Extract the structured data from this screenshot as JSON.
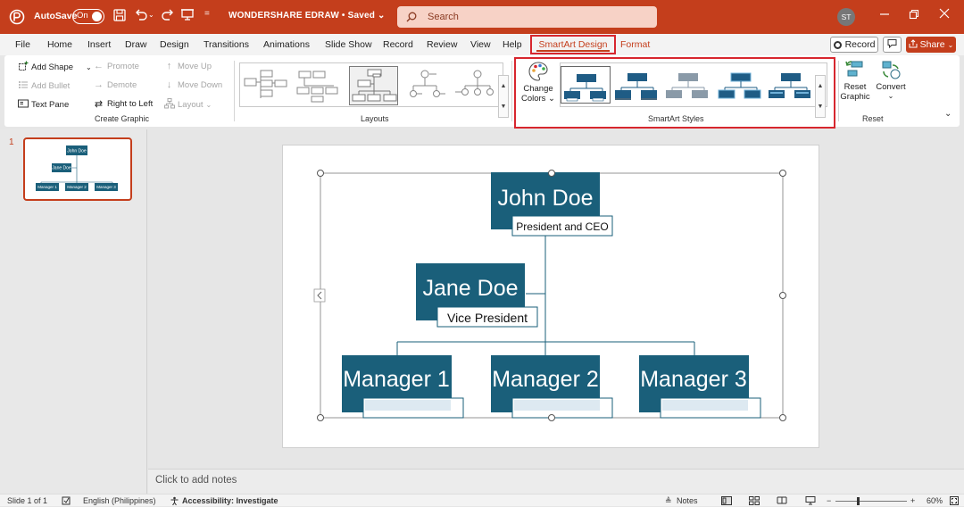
{
  "titlebar": {
    "autosave_label": "AutoSave",
    "autosave_state": "On",
    "document_title": "WONDERSHARE EDRAW • Saved ⌄",
    "search_placeholder": "Search",
    "user_initials": "ST",
    "accent_color": "#c43e1c"
  },
  "tabs": {
    "items": [
      "File",
      "Home",
      "Insert",
      "Draw",
      "Design",
      "Transitions",
      "Animations",
      "Slide Show",
      "Record",
      "Review",
      "View",
      "Help"
    ],
    "active": "SmartArt Design",
    "contextual": "Format",
    "record_label": "Record",
    "share_label": "Share"
  },
  "ribbon": {
    "create_graphic": {
      "label": "Create Graphic",
      "add_shape": "Add Shape",
      "add_bullet": "Add Bullet",
      "text_pane": "Text Pane",
      "promote": "Promote",
      "demote": "Demote",
      "right_to_left": "Right to Left",
      "move_up": "Move Up",
      "move_down": "Move Down",
      "layout": "Layout"
    },
    "layouts": {
      "label": "Layouts"
    },
    "smartart_styles": {
      "label": "SmartArt Styles",
      "change_colors_line1": "Change",
      "change_colors_line2": "Colors ⌄",
      "style_color": "#1f5c85",
      "style_color_gray": "#8a9aa8"
    },
    "reset": {
      "label": "Reset",
      "reset_graphic_line1": "Reset",
      "reset_graphic_line2": "Graphic",
      "convert": "Convert",
      "convert_arrow": "⌄"
    }
  },
  "slide_panel": {
    "slide_number": "1",
    "thumb": {
      "top": "John Doe",
      "mid": "Jane Doe",
      "managers": [
        "Manager 1",
        "Manager 2",
        "Manager 3"
      ]
    }
  },
  "org_chart": {
    "box_color": "#1a5f7a",
    "ceo": {
      "name": "John Doe",
      "title": "President and CEO"
    },
    "assistant": {
      "name": "Jane Doe",
      "title": "Vice President"
    },
    "managers": [
      {
        "name": "Manager 1"
      },
      {
        "name": "Manager 2"
      },
      {
        "name": "Manager 3"
      }
    ]
  },
  "notes": {
    "placeholder": "Click to add notes"
  },
  "status": {
    "slide_info": "Slide 1 of 1",
    "language": "English (Philippines)",
    "accessibility": "Accessibility: Investigate",
    "notes": "Notes",
    "zoom": "60%"
  }
}
